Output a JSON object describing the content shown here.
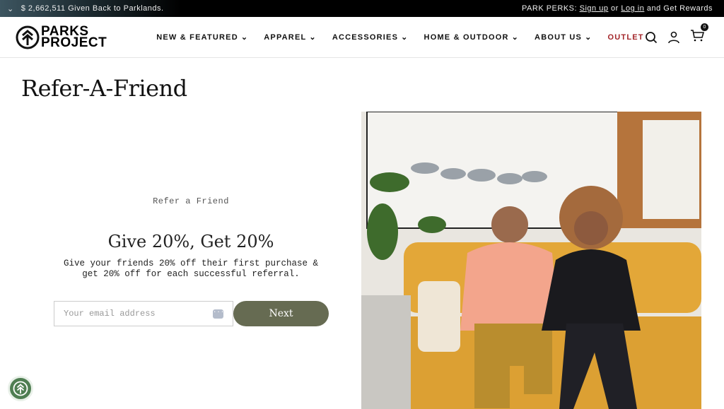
{
  "topbar": {
    "announcement": "$ 2,662,511 Given Back to Parklands.",
    "perks_label": "PARK PERKS:",
    "sign_up": "Sign up",
    "or": "or",
    "log_in": "Log in",
    "rewards": "and Get Rewards"
  },
  "header": {
    "logo": {
      "line1": "PARKS",
      "line2": "PROJECT"
    },
    "nav": [
      {
        "label": "NEW & FEATURED"
      },
      {
        "label": "APPAREL"
      },
      {
        "label": "ACCESSORIES"
      },
      {
        "label": "HOME & OUTDOOR"
      },
      {
        "label": "ABOUT US"
      },
      {
        "label": "OUTLET"
      }
    ],
    "cart_count": "0",
    "outlet_color": "#a3262a"
  },
  "page": {
    "title": "Refer-A-Friend"
  },
  "referral": {
    "eyebrow": "Refer a Friend",
    "headline": "Give 20%, Get 20%",
    "desc_line1": "Give your friends 20% off their first purchase &",
    "desc_line2": "get 20% off for each successful referral.",
    "email_placeholder": "Your email address",
    "next_label": "Next",
    "button_color": "#666b52"
  }
}
